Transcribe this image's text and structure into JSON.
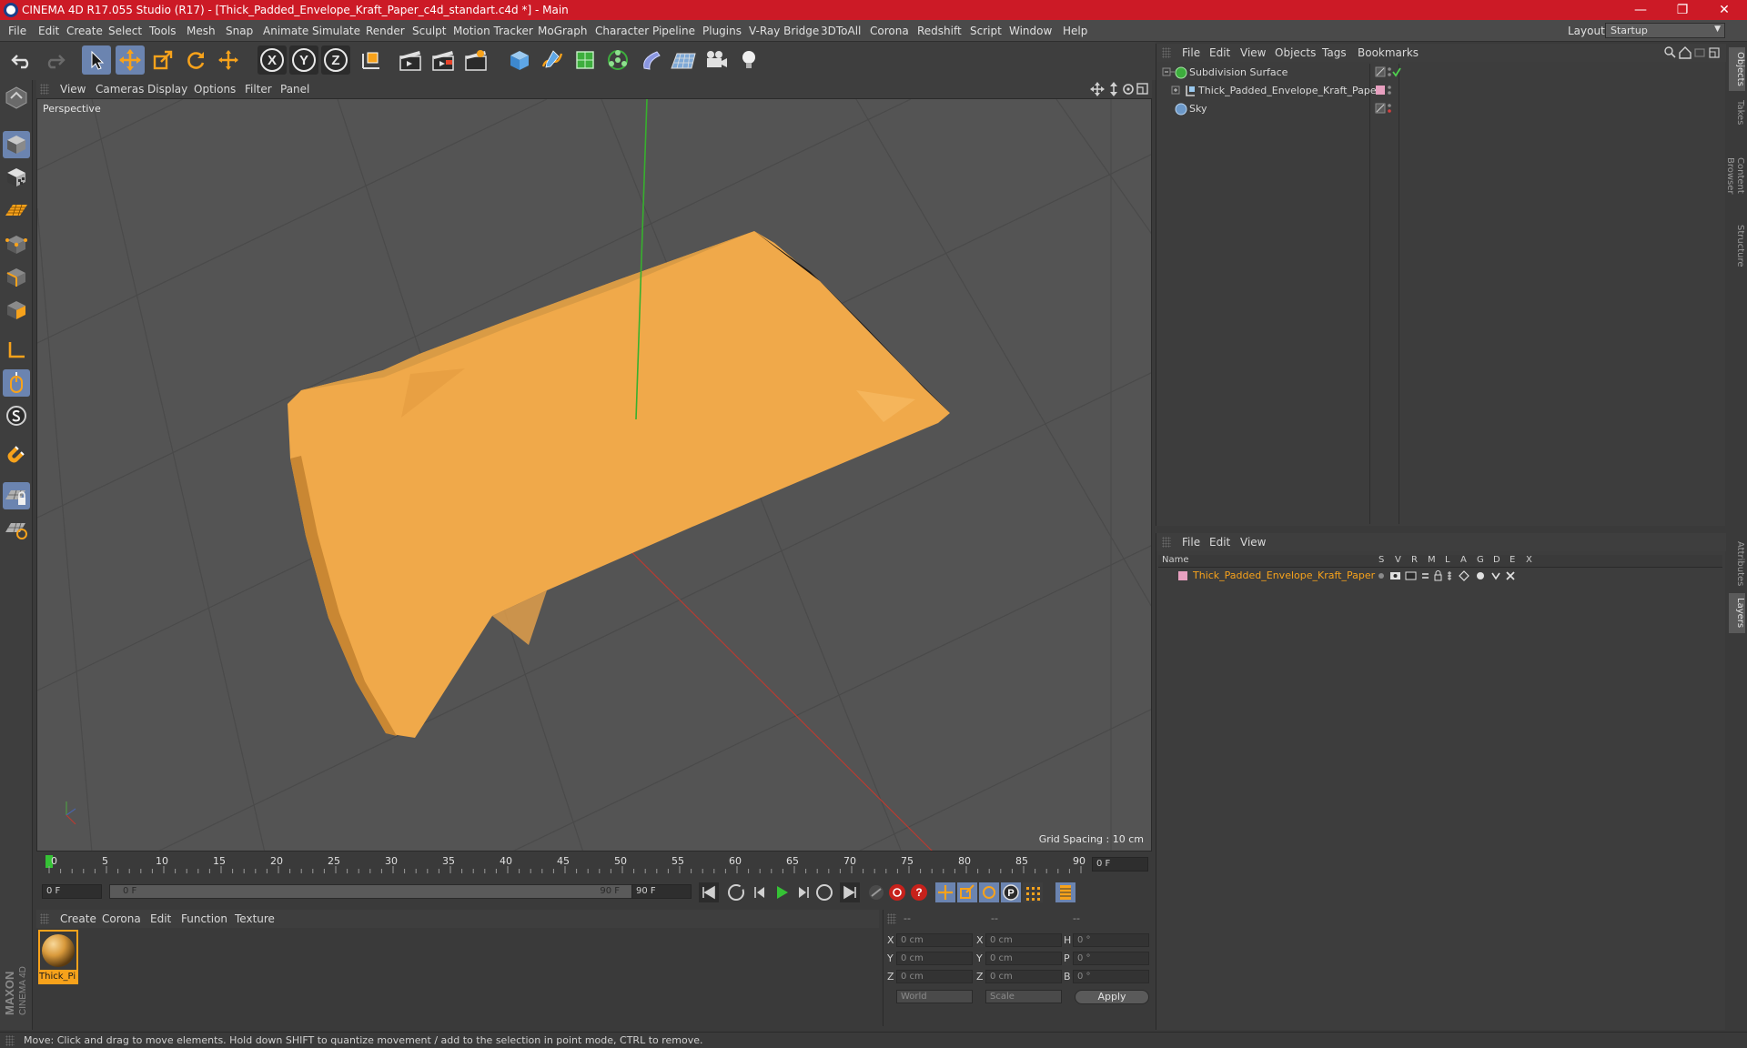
{
  "window": {
    "title": "CINEMA 4D R17.055 Studio (R17) - [Thick_Padded_Envelope_Kraft_Paper_c4d_standart.c4d *] - Main",
    "minimize": "—",
    "restore": "❐",
    "close": "✕"
  },
  "menubar": {
    "items": [
      "File",
      "Edit",
      "Create",
      "Select",
      "Tools",
      "Mesh",
      "Snap",
      "Animate",
      "Simulate",
      "Render",
      "Sculpt",
      "Motion Tracker",
      "MoGraph",
      "Character",
      "Pipeline",
      "Plugins",
      "V-Ray Bridge",
      "3DToAll",
      "Corona",
      "Redshift",
      "Script",
      "Window",
      "Help"
    ],
    "layout_label": "Layout:",
    "layout_value": "Startup"
  },
  "toolbar": {
    "axis_x": "X",
    "axis_y": "Y",
    "axis_z": "Z"
  },
  "viewport": {
    "menu": [
      "View",
      "Cameras",
      "Display",
      "Options",
      "Filter",
      "Panel"
    ],
    "camera_label": "Perspective",
    "grid_spacing": "Grid Spacing : 10 cm",
    "object_color": "#f0a94a"
  },
  "timeline": {
    "ticks": [
      "0",
      "5",
      "10",
      "15",
      "20",
      "25",
      "30",
      "35",
      "40",
      "45",
      "50",
      "55",
      "60",
      "65",
      "70",
      "75",
      "80",
      "85",
      "90"
    ],
    "current_frame": "0 F",
    "start_frame": "0 F",
    "range_start": "0 F",
    "range_end": "90 F",
    "end_frame": "90 F"
  },
  "materials": {
    "menu": [
      "Create",
      "Corona",
      "Edit",
      "Function",
      "Texture"
    ],
    "items": [
      {
        "name": "Thick_Pi"
      }
    ]
  },
  "coordinates": {
    "header": [
      "--",
      "--",
      "--"
    ],
    "rows": [
      {
        "a": "X",
        "a_val": "0 cm",
        "b": "X",
        "b_val": "0 cm",
        "c": "H",
        "c_val": "0 °"
      },
      {
        "a": "Y",
        "a_val": "0 cm",
        "b": "Y",
        "b_val": "0 cm",
        "c": "P",
        "c_val": "0 °"
      },
      {
        "a": "Z",
        "a_val": "0 cm",
        "b": "Z",
        "b_val": "0 cm",
        "c": "B",
        "c_val": "0 °"
      }
    ],
    "mode": "World",
    "type": "Scale",
    "apply": "Apply"
  },
  "object_manager": {
    "menu": [
      "File",
      "Edit",
      "View",
      "Objects",
      "Tags",
      "Bookmarks"
    ],
    "objects": [
      {
        "name": "Subdivision Surface"
      },
      {
        "name": "Thick_Padded_Envelope_Kraft_Paper"
      },
      {
        "name": "Sky"
      }
    ]
  },
  "layer_manager": {
    "menu": [
      "File",
      "Edit",
      "View"
    ],
    "columns": [
      "Name",
      "S",
      "V",
      "R",
      "M",
      "L",
      "A",
      "G",
      "D",
      "E",
      "X"
    ],
    "layers": [
      {
        "name": "Thick_Padded_Envelope_Kraft_Paper",
        "color": "#e8a0c0"
      }
    ]
  },
  "right_tabs": [
    "Objects",
    "Takes",
    "Content Browser",
    "Structure",
    "Attributes",
    "Layers"
  ],
  "status": {
    "text": "Move: Click and drag to move elements. Hold down SHIFT to quantize movement / add to the selection in point mode, CTRL to remove."
  },
  "logo": {
    "brand": "MAXON",
    "product": "CINEMA 4D"
  }
}
